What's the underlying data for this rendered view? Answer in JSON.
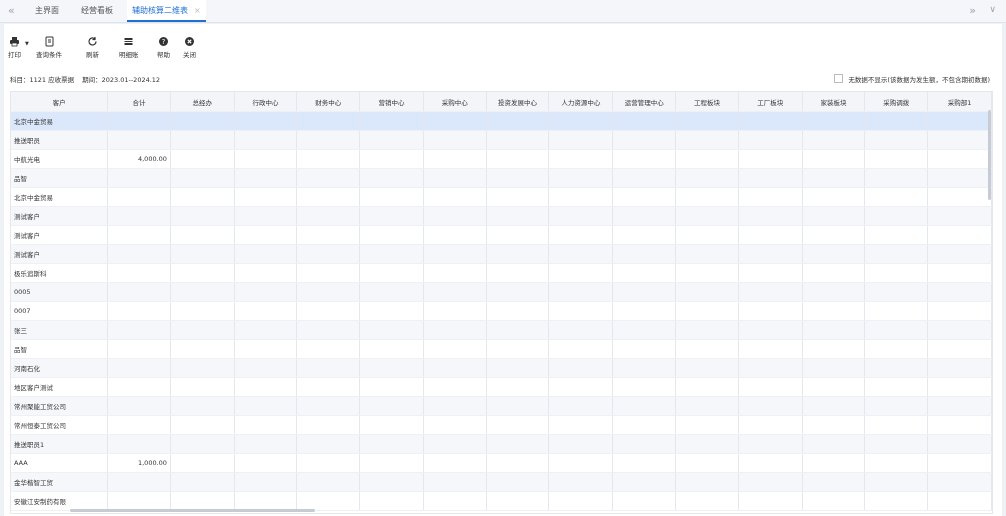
{
  "tabs": {
    "nav_left": "«",
    "items": [
      {
        "label": "主界面",
        "close": ""
      },
      {
        "label": "经营看板",
        "close": ""
      },
      {
        "label": "辅助核算二维表",
        "close": "×"
      }
    ],
    "nav_right": "»",
    "dropdown": "∨"
  },
  "toolbar": {
    "print": "打印",
    "print_arrow": "▼",
    "query": "查询条件",
    "refresh": "刷新",
    "detail": "明细账",
    "help": "帮助",
    "close": "关闭"
  },
  "meta": {
    "subject": "科目：1121 应收票据",
    "period": "期间：2023.01--2024.12"
  },
  "option": {
    "label": "无数据不显示(该数据为发生额，不包含期初数据)"
  },
  "table": {
    "columns": [
      "客户",
      "合计",
      "总经办",
      "行政中心",
      "财务中心",
      "营销中心",
      "采购中心",
      "投资发展中心",
      "人力资源中心",
      "运营管理中心",
      "工程板块",
      "工厂板块",
      "家装板块",
      "采购调拨",
      "采购部1"
    ],
    "rows": [
      {
        "name": "北京中金贸易",
        "total": ""
      },
      {
        "name": "推送职员",
        "total": ""
      },
      {
        "name": "中航光电",
        "total": "4,000.00"
      },
      {
        "name": "品智",
        "total": ""
      },
      {
        "name": "北京中金贸易",
        "total": ""
      },
      {
        "name": "测试客户",
        "total": ""
      },
      {
        "name": "测试客户",
        "total": ""
      },
      {
        "name": "测试客户",
        "total": ""
      },
      {
        "name": "极乐追斯科",
        "total": ""
      },
      {
        "name": "0005",
        "total": ""
      },
      {
        "name": "0007",
        "total": ""
      },
      {
        "name": "张三",
        "total": ""
      },
      {
        "name": "品智",
        "total": ""
      },
      {
        "name": "河南石化",
        "total": ""
      },
      {
        "name": "地区客户测试",
        "total": ""
      },
      {
        "name": "常州聚能工贸公司",
        "total": ""
      },
      {
        "name": "常州恒泰工贸公司",
        "total": ""
      },
      {
        "name": "推送职员1",
        "total": ""
      },
      {
        "name": "AAA",
        "total": "1,000.00"
      },
      {
        "name": "金华楷智工贸",
        "total": ""
      },
      {
        "name": "安徽江安制药有限",
        "total": ""
      }
    ]
  },
  "colors": {
    "accent": "#1f6fd1",
    "selected_row": "#dbe8fb",
    "stripe": "#f5f7fa"
  }
}
